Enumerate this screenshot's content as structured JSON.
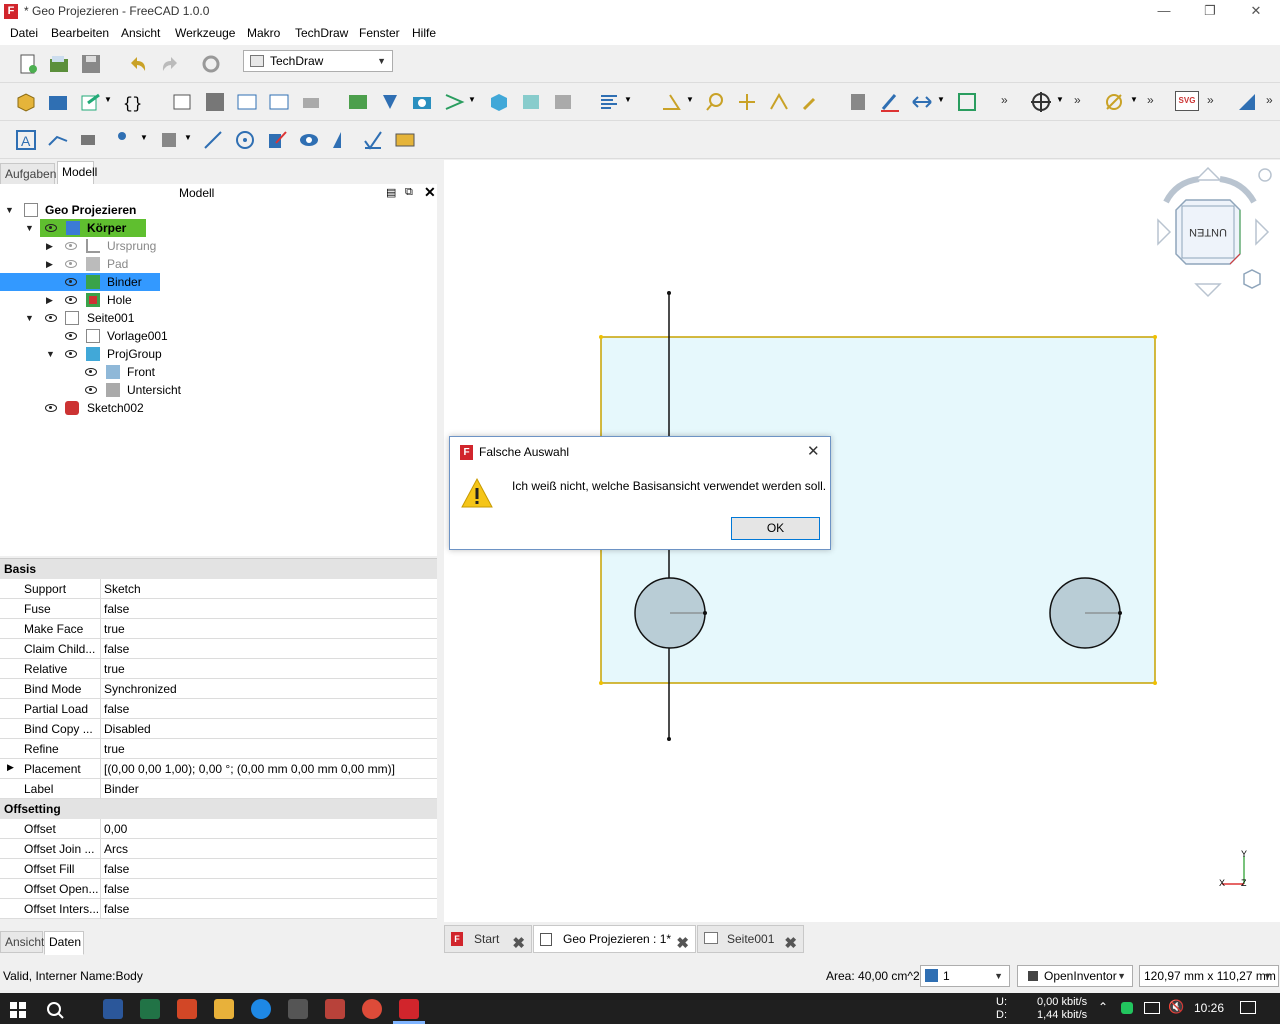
{
  "window": {
    "title": "* Geo Projezieren - FreeCAD 1.0.0"
  },
  "menu": [
    "Datei",
    "Bearbeiten",
    "Ansicht",
    "Werkzeuge",
    "Makro",
    "TechDraw",
    "Fenster",
    "Hilfe"
  ],
  "toolbar": {
    "workbench": "TechDraw",
    "svg_label": "SVG",
    "overflow": "»"
  },
  "left_tabs": [
    "Aufgaben",
    "Modell"
  ],
  "tree": {
    "header": "Modell",
    "items": [
      {
        "label": "Geo Projezieren",
        "bold": true
      },
      {
        "label": "Körper",
        "bold": true
      },
      {
        "label": "Ursprung"
      },
      {
        "label": "Pad"
      },
      {
        "label": "Binder"
      },
      {
        "label": "Hole"
      },
      {
        "label": "Seite001"
      },
      {
        "label": "Vorlage001"
      },
      {
        "label": "ProjGroup"
      },
      {
        "label": "Front"
      },
      {
        "label": "Untersicht"
      },
      {
        "label": "Sketch002"
      }
    ]
  },
  "properties": {
    "groups": [
      {
        "name": "Basis",
        "rows": [
          {
            "k": "Support",
            "v": "Sketch"
          },
          {
            "k": "Fuse",
            "v": "false"
          },
          {
            "k": "Make Face",
            "v": "true"
          },
          {
            "k": "Claim Child...",
            "v": "false"
          },
          {
            "k": "Relative",
            "v": "true"
          },
          {
            "k": "Bind Mode",
            "v": "Synchronized"
          },
          {
            "k": "Partial Load",
            "v": "false"
          },
          {
            "k": "Bind Copy ...",
            "v": "Disabled"
          },
          {
            "k": "Refine",
            "v": "true"
          },
          {
            "k": "Placement",
            "v": "[(0,00 0,00 1,00); 0,00 °; (0,00 mm  0,00 mm  0,00 mm)]"
          },
          {
            "k": "Label",
            "v": "Binder"
          }
        ]
      },
      {
        "name": "Offsetting",
        "rows": [
          {
            "k": "Offset",
            "v": "0,00"
          },
          {
            "k": "Offset Join ...",
            "v": "Arcs"
          },
          {
            "k": "Offset Fill",
            "v": "false"
          },
          {
            "k": "Offset Open...",
            "v": "false"
          },
          {
            "k": "Offset Inters...",
            "v": "false"
          }
        ]
      }
    ]
  },
  "bottom_tabs": [
    "Ansicht",
    "Daten"
  ],
  "navcube": {
    "face": "UNTEN",
    "axis_y": "Y",
    "axis_x": "X",
    "axis_z": "Z"
  },
  "dialog": {
    "title": "Falsche Auswahl",
    "message": "Ich weiß nicht, welche Basisansicht verwendet werden soll.",
    "ok": "OK"
  },
  "doc_tabs": [
    "Start",
    "Geo Projezieren : 1*",
    "Seite001"
  ],
  "status": {
    "left": "Valid, Interner Name:Body",
    "area": "Area: 40,00 cm^2",
    "combo": "1",
    "nav_style": "OpenInventor",
    "dims": "120,97 mm x 110,27 mm"
  },
  "taskbar": {
    "net_u": "U:",
    "net_d": "D:",
    "up": "0,00 kbit/s",
    "down": "1,44 kbit/s",
    "time": "10:26"
  },
  "colors": {
    "selection": "#3399ff",
    "highlight": "#5fbf2f",
    "face": "#e6f8fc",
    "hole": "#b9cdd6",
    "edge": "#c7a200",
    "accent": "#0078d7"
  }
}
